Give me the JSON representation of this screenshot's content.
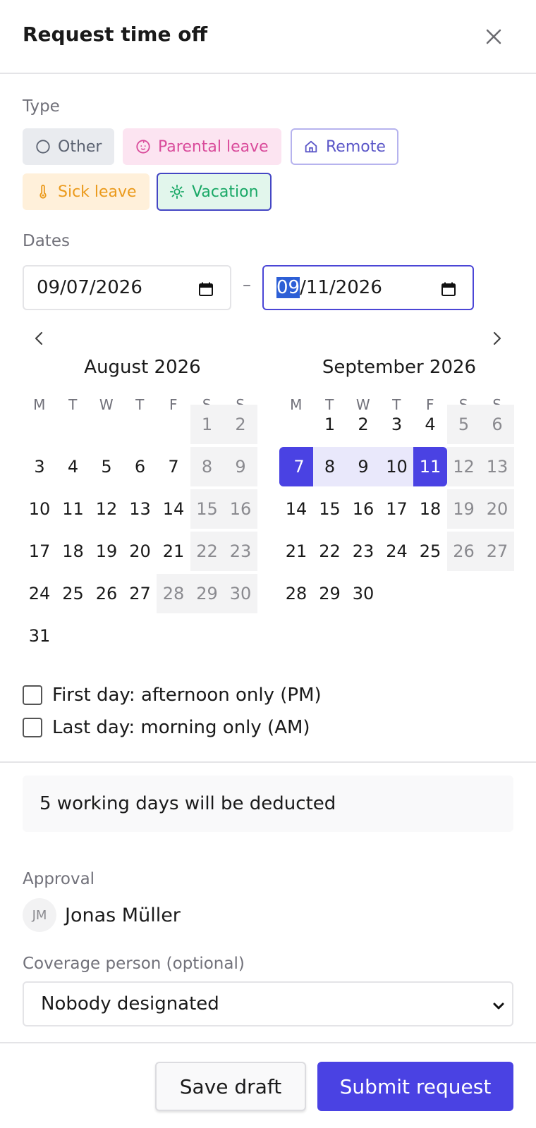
{
  "header": {
    "title": "Request time off"
  },
  "type": {
    "label": "Type",
    "options": {
      "other": "Other",
      "parental": "Parental leave",
      "remote": "Remote",
      "sick": "Sick leave",
      "vacation": "Vacation"
    },
    "selected": "Vacation",
    "colors": {
      "other": "#5b6271",
      "parental": "#d94b9b",
      "remote": "#5b57c8",
      "sick": "#eb9a1c",
      "vacation": "#19a866"
    }
  },
  "dates": {
    "label": "Dates",
    "separator": "–",
    "start_value": "09/07/2026",
    "end_month": "09",
    "end_rest": "/11/2026"
  },
  "calendar": {
    "weekdays": [
      "M",
      "T",
      "W",
      "T",
      "F",
      "S",
      "S"
    ],
    "months": [
      {
        "title": "August 2026",
        "weeks": [
          [
            "",
            "",
            "",
            "",
            "",
            "1",
            "2"
          ],
          [
            "3",
            "4",
            "5",
            "6",
            "7",
            "8",
            "9"
          ],
          [
            "10",
            "11",
            "12",
            "13",
            "14",
            "15",
            "16"
          ],
          [
            "17",
            "18",
            "19",
            "20",
            "21",
            "22",
            "23"
          ],
          [
            "24",
            "25",
            "26",
            "27",
            "28",
            "29",
            "30"
          ],
          [
            "31",
            "",
            "",
            "",
            "",
            "",
            ""
          ]
        ],
        "muted_days": [
          "28"
        ]
      },
      {
        "title": "September 2026",
        "weeks": [
          [
            "",
            "1",
            "2",
            "3",
            "4",
            "5",
            "6"
          ],
          [
            "7",
            "8",
            "9",
            "10",
            "11",
            "12",
            "13"
          ],
          [
            "14",
            "15",
            "16",
            "17",
            "18",
            "19",
            "20"
          ],
          [
            "21",
            "22",
            "23",
            "24",
            "25",
            "26",
            "27"
          ],
          [
            "28",
            "29",
            "30",
            "",
            "",
            "",
            ""
          ]
        ],
        "range_start": "7",
        "range_end": "11"
      }
    ]
  },
  "options": {
    "first_day_pm": "First day: afternoon only (PM)",
    "last_day_am": "Last day: morning only (AM)"
  },
  "summary": "5 working days will be deducted",
  "approval": {
    "label": "Approval",
    "initials": "JM",
    "name": "Jonas Müller"
  },
  "coverage": {
    "label": "Coverage person (optional)",
    "value": "Nobody designated"
  },
  "footer": {
    "save_label": "Save draft",
    "submit_label": "Submit request"
  },
  "accent_color": "#4a42e3"
}
